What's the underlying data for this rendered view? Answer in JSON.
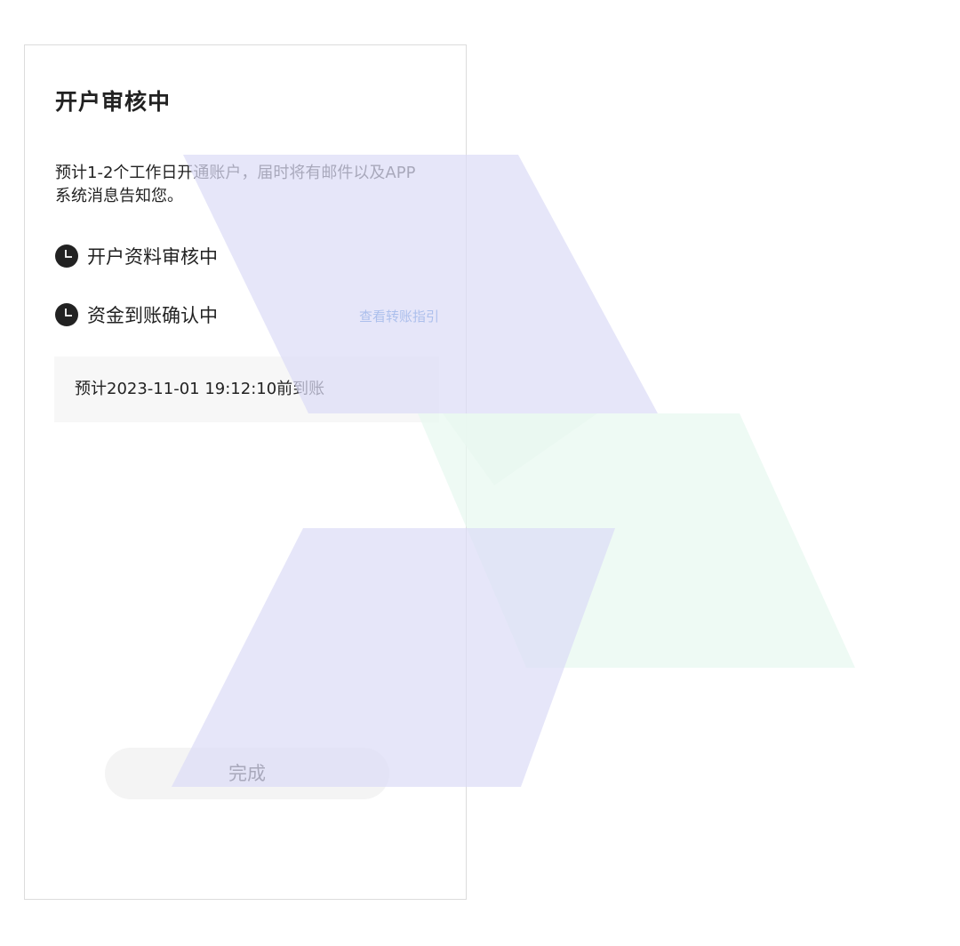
{
  "page": {
    "title": "开户审核中",
    "description": "预计1-2个工作日开通账户，届时将有邮件以及APP系统消息告知您。"
  },
  "steps": [
    {
      "label": "开户资料审核中",
      "icon": "clock-icon"
    },
    {
      "label": "资金到账确认中",
      "icon": "clock-icon"
    }
  ],
  "guide_link": "查看转账指引",
  "eta_text": "预计2023-11-01 19:12:10前到账",
  "done_button": "完成",
  "colors": {
    "link": "#2f74d0",
    "decor_purple": "#dcdcf7",
    "decor_green": "#e8f8f0"
  }
}
